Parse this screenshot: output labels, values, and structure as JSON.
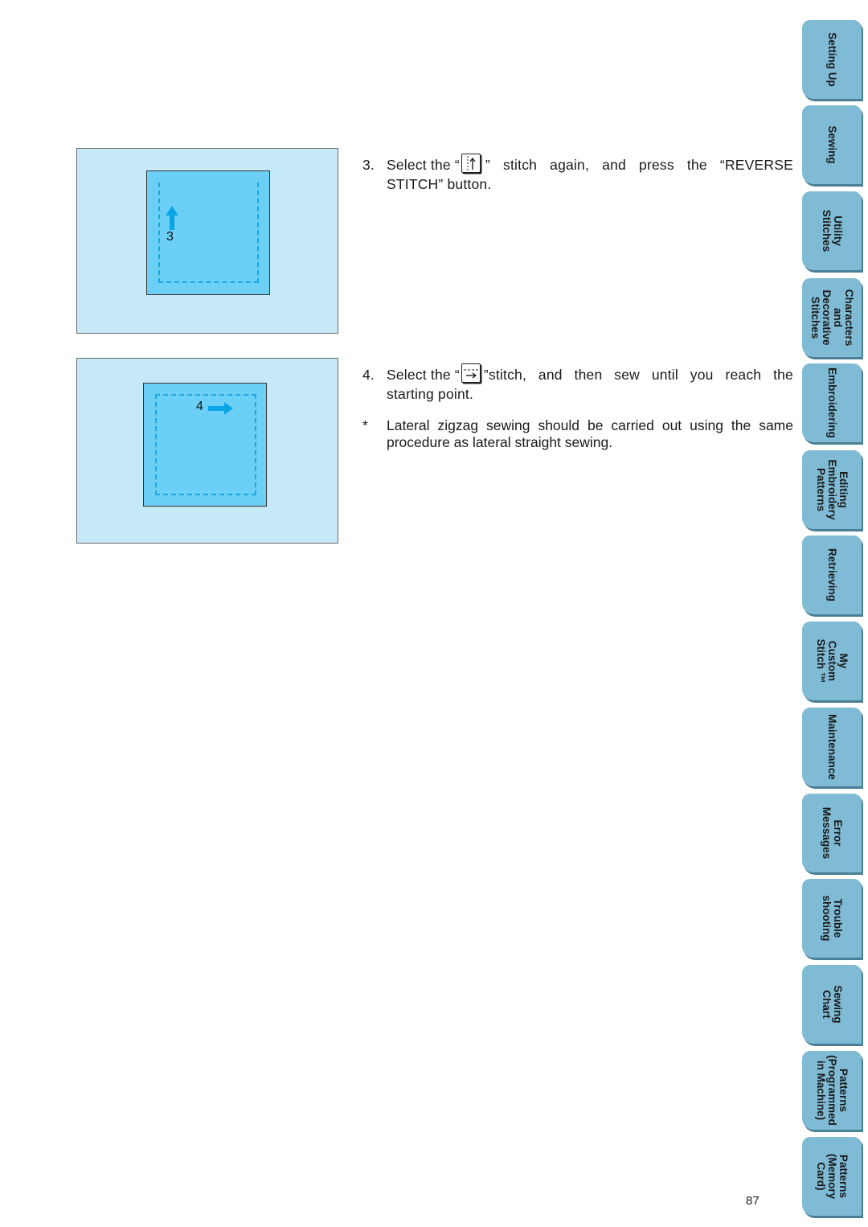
{
  "figures": [
    {
      "step_label": "3",
      "arrow_direction": "up",
      "seam": "open-top"
    },
    {
      "step_label": "4",
      "arrow_direction": "right",
      "seam": "closed"
    }
  ],
  "colors": {
    "figure_bg": "#c6e9f8",
    "fabric": "#6ccff5",
    "seam": "#1aa7e8",
    "arrow": "#0aa5e6",
    "tab": "#80bbd6",
    "tab_shadow": "#4a7f96"
  },
  "steps": [
    {
      "number": "3.",
      "text_before_icon": "Select the “",
      "icon": "straight-stitch-reverse-icon",
      "text_after_icon": "” stitch again, and press the “REVERSE",
      "text_line2": "STITCH” button."
    },
    {
      "number": "4.",
      "text_before_icon": "Select the “",
      "icon": "lateral-stitch-right-icon",
      "text_after_icon": "”stitch, and then sew until you reach the",
      "text_line2": "starting point."
    }
  ],
  "note": {
    "marker": "*",
    "text": "Lateral zigzag sewing should be carried out using the same procedure as lateral straight sewing."
  },
  "page_number": "87",
  "tabs": [
    {
      "label": "Setting Up"
    },
    {
      "label": "Sewing"
    },
    {
      "label": "Utility\nStitches"
    },
    {
      "label": "Characters\nand\nDecorative\nStitches"
    },
    {
      "label": "Embroidering"
    },
    {
      "label": "Editing\nEmbroidery\nPatterns"
    },
    {
      "label": "Retrieving"
    },
    {
      "label": "My\nCustom\nStitch ™"
    },
    {
      "label": "Maintenance"
    },
    {
      "label": "Error\nMessages"
    },
    {
      "label": "Trouble\nshooting"
    },
    {
      "label": "Sewing\nChart"
    },
    {
      "label": "Patterns\n(Programmed\nin Machine)"
    },
    {
      "label": "Patterns\n(Memory\nCard)"
    }
  ]
}
